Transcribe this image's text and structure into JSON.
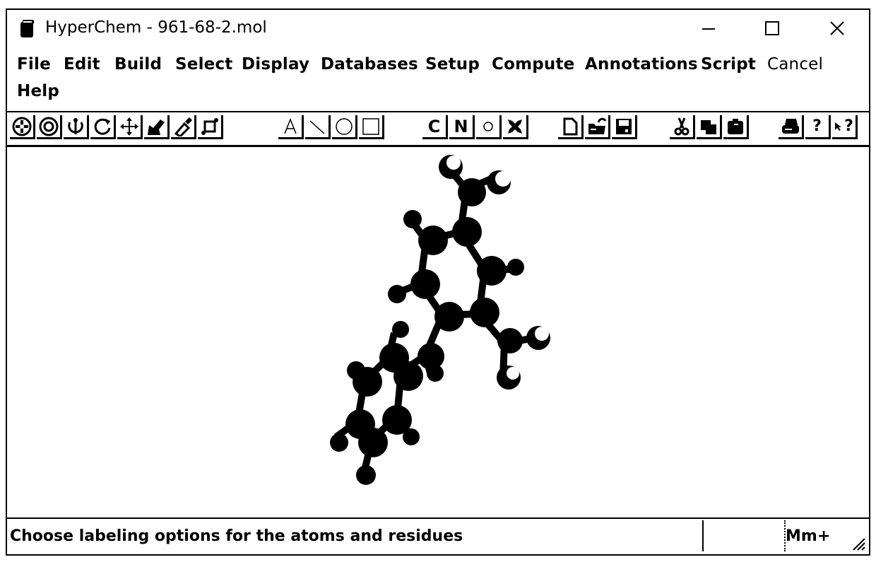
{
  "window": {
    "title": "HyperChem - 961-68-2.mol",
    "app_icon": "hyperchem-app-icon",
    "controls": {
      "minimize": "—",
      "maximize": "☐",
      "close": "✕"
    }
  },
  "menubar": {
    "items": [
      {
        "label": "File"
      },
      {
        "label": "Edit"
      },
      {
        "label": "Build"
      },
      {
        "label": "Select"
      },
      {
        "label": "Display"
      },
      {
        "label": "Databases"
      },
      {
        "label": "Setup"
      },
      {
        "label": "Compute"
      },
      {
        "label": "Annotations"
      },
      {
        "label": "Script"
      },
      {
        "label": "Cancel"
      },
      {
        "label": "Help"
      }
    ]
  },
  "toolbar": {
    "groups": [
      [
        "draw-tool",
        "select-tool",
        "rotate-out-of-plane",
        "rotate-in-plane",
        "translate-tool",
        "magnify-tool",
        "z-clip-tool",
        "z-translate-tool"
      ],
      [
        "text-annotation",
        "line-annotation",
        "ellipse-annotation",
        "rectangle-annotation"
      ],
      [
        "carbon-element",
        "nitrogen-element",
        "hydrogen-toggle",
        "atom-element"
      ],
      [
        "new-file",
        "open-file",
        "save-file"
      ],
      [
        "cut",
        "copy",
        "paste"
      ],
      [
        "print",
        "help",
        "context-help"
      ]
    ],
    "labels": {
      "carbon": "C",
      "nitrogen": "N",
      "text": "A",
      "help": "?",
      "context_help": "?"
    }
  },
  "workspace": {
    "molecule": "961-68-2.mol",
    "render_style": "balls-and-cylinders"
  },
  "statusbar": {
    "message": "Choose labeling options for the atoms and residues",
    "field_2": "",
    "mode": "Mm+"
  }
}
